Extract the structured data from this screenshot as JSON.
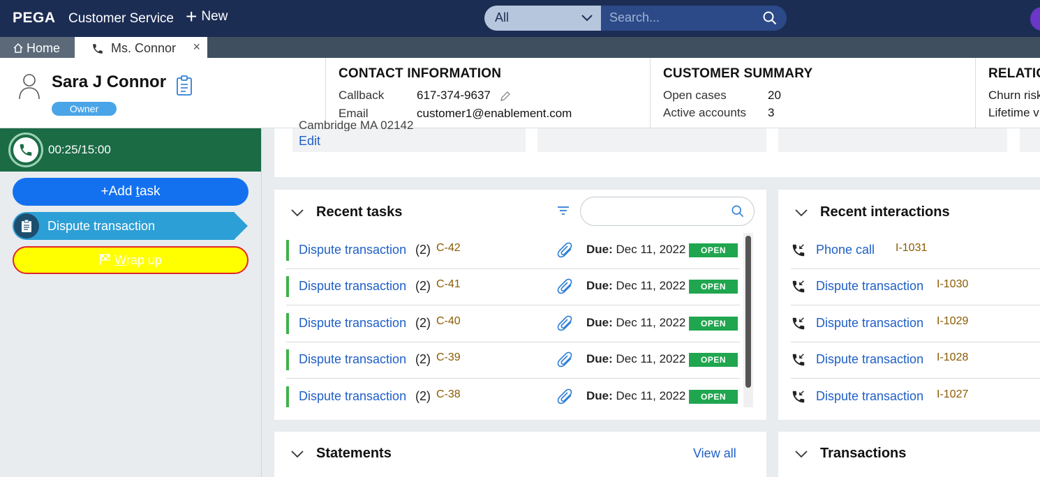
{
  "topbar": {
    "logo": "PEGA",
    "app_name": "Customer Service",
    "new_label": "New",
    "search_scope": "All",
    "search_placeholder": "Search..."
  },
  "tabs": {
    "home_label": "Home",
    "active_label": "Ms. Connor",
    "close_glyph": "×"
  },
  "customer": {
    "name": "Sara J Connor",
    "role_badge": "Owner"
  },
  "contact": {
    "title": "CONTACT INFORMATION",
    "callback_label": "Callback",
    "callback_value": "617-374-9637",
    "email_label": "Email",
    "email_value": "customer1@enablement.com"
  },
  "summary": {
    "title": "CUSTOMER SUMMARY",
    "open_cases_label": "Open cases",
    "open_cases_value": "20",
    "active_accounts_label": "Active accounts",
    "active_accounts_value": "3"
  },
  "relation": {
    "title": "RELATIO",
    "churn_label": "Churn risk",
    "lifetime_label": "Lifetime v"
  },
  "call": {
    "timer": "00:25/15:00"
  },
  "actions": {
    "add_task_plus": "+",
    "add_task_pre": "Add ",
    "add_task_u": "t",
    "add_task_post": "ask",
    "dispute_step": "Dispute transaction",
    "wrap_u": "W",
    "wrap_post": "rap up"
  },
  "strip": {
    "address_partial": "Cambridge MA 02142",
    "edit_label": "Edit"
  },
  "recent_tasks": {
    "title": "Recent tasks",
    "due_label": "Due:",
    "items": [
      {
        "name": "Dispute transaction",
        "count": "(2)",
        "id": "C-42",
        "due": "Dec 11, 2022",
        "status": "OPEN"
      },
      {
        "name": "Dispute transaction",
        "count": "(2)",
        "id": "C-41",
        "due": "Dec 11, 2022",
        "status": "OPEN"
      },
      {
        "name": "Dispute transaction",
        "count": "(2)",
        "id": "C-40",
        "due": "Dec 11, 2022",
        "status": "OPEN"
      },
      {
        "name": "Dispute transaction",
        "count": "(2)",
        "id": "C-39",
        "due": "Dec 11, 2022",
        "status": "OPEN"
      },
      {
        "name": "Dispute transaction",
        "count": "(2)",
        "id": "C-38",
        "due": "Dec 11, 2022",
        "status": "OPEN"
      }
    ]
  },
  "recent_interactions": {
    "title": "Recent interactions",
    "items": [
      {
        "name": "Phone call",
        "id": "I-1031"
      },
      {
        "name": "Dispute transaction",
        "id": "I-1030"
      },
      {
        "name": "Dispute transaction",
        "id": "I-1029"
      },
      {
        "name": "Dispute transaction",
        "id": "I-1028"
      },
      {
        "name": "Dispute transaction",
        "id": "I-1027"
      }
    ]
  },
  "statements": {
    "title": "Statements",
    "view_all": "View all"
  },
  "transactions": {
    "title": "Transactions"
  },
  "colors": {
    "topbar": "#1c2d54",
    "call_bar": "#1b6b45",
    "primary": "#1371f0",
    "link": "#1f5fc7",
    "open_status": "#1fa64f",
    "wrap_up_bg": "#ffff00",
    "wrap_up_border": "#e0262a"
  }
}
